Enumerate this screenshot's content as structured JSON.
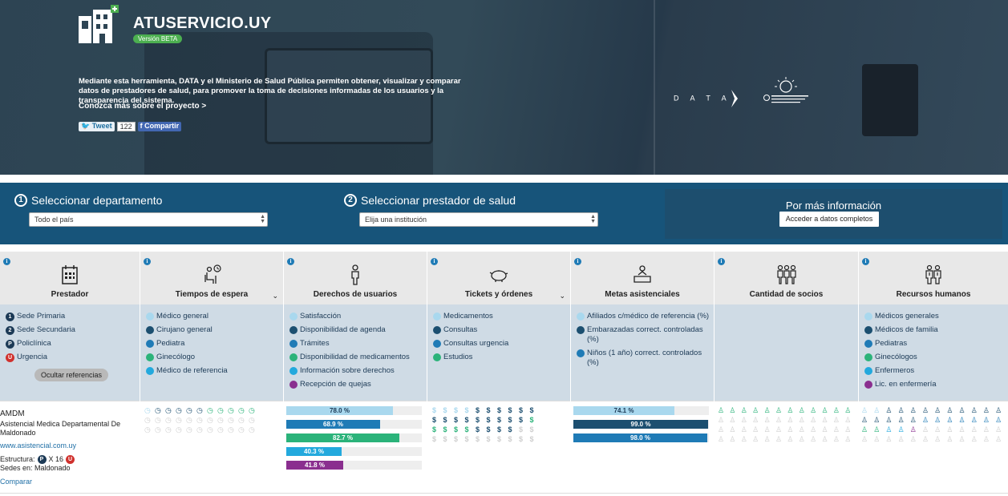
{
  "hero": {
    "brand": "ATUSERVICIO.UY",
    "beta": "Versión BETA",
    "intro": "Mediante esta herramienta, DATA y el Ministerio de Salud Pública permiten obtener, visualizar y comparar datos de prestadores de salud, para promover la toma de decisiones informadas de los usuarios y la transparencia del sistema.",
    "more_link": "Conozca más sobre el proyecto >",
    "tweet_label": "Tweet",
    "tweet_count": "122",
    "share_label": "Compartir",
    "data_logo": "D A T A"
  },
  "selectors": {
    "dept_title": "Seleccionar departamento",
    "dept_num": "1",
    "dept_value": "Todo el país",
    "prov_title": "Seleccionar prestador de salud",
    "prov_num": "2",
    "prov_placeholder": "Elija una institución",
    "info_title": "Por más información",
    "info_button": "Acceder a datos completos"
  },
  "columns": {
    "prestador": {
      "label": "Prestador",
      "legend": [
        "Sede Primaria",
        "Sede Secundaria",
        "Policlínica",
        "Urgencia"
      ],
      "legend_marks": [
        "1",
        "2",
        "P",
        "U"
      ],
      "hide_button": "Ocultar referencias"
    },
    "tiempos": {
      "label": "Tiempos de espera",
      "legend": [
        "Médico general",
        "Cirujano general",
        "Pediatra",
        "Ginecólogo",
        "Médico de referencia"
      ]
    },
    "derechos": {
      "label": "Derechos de usuarios",
      "legend": [
        "Satisfacción",
        "Disponibilidad de agenda",
        "Trámites",
        "Disponibilidad de medicamentos",
        "Información sobre derechos",
        "Recepción de quejas"
      ],
      "bars": [
        {
          "text": "78.0 %",
          "value": 78.0
        },
        {
          "text": "68.9 %",
          "value": 68.9
        },
        {
          "text": "82.7 %",
          "value": 82.7
        },
        {
          "text": "40.3 %",
          "value": 40.3
        },
        {
          "text": "41.8 %",
          "value": 41.8
        }
      ]
    },
    "tickets": {
      "label": "Tickets y órdenes",
      "legend": [
        "Medicamentos",
        "Consultas",
        "Consultas urgencia",
        "Estudios"
      ]
    },
    "metas": {
      "label": "Metas asistenciales",
      "legend": [
        "Afiliados c/médico de referencia (%)",
        "Embarazadas correct. controladas (%)",
        "Niños (1 año) correct. controlados (%)"
      ],
      "bars": [
        {
          "text": "74.1 %",
          "value": 74.1
        },
        {
          "text": "99.0 %",
          "value": 99.0
        },
        {
          "text": "98.0 %",
          "value": 98.0
        }
      ]
    },
    "socios": {
      "label": "Cantidad de socios"
    },
    "rrhh": {
      "label": "Recursos humanos",
      "legend": [
        "Médicos generales",
        "Médicos de familia",
        "Pediatras",
        "Ginecólogos",
        "Enfermeros",
        "Lic. en enfermería"
      ]
    }
  },
  "provider": {
    "short": "AMDM",
    "name": "Asistencial Medica Departamental De Maldonado",
    "url": "www.asistencial.com.uy",
    "estructura_label": "Estructura:",
    "estructura_mark_p": "P",
    "estructura_count": "X 16",
    "estructura_mark_u": "U",
    "sedes": "Sedes en: Maldonado",
    "compare": "Comparar"
  },
  "colors": {
    "light": "#a9d8ee",
    "dark": "#1c4f70",
    "blue": "#1f7bb6",
    "green": "#2bb37a",
    "cyan": "#23a9dd",
    "purple": "#8a2f8f",
    "urgent": "#d0312d",
    "band": "#17547a"
  }
}
